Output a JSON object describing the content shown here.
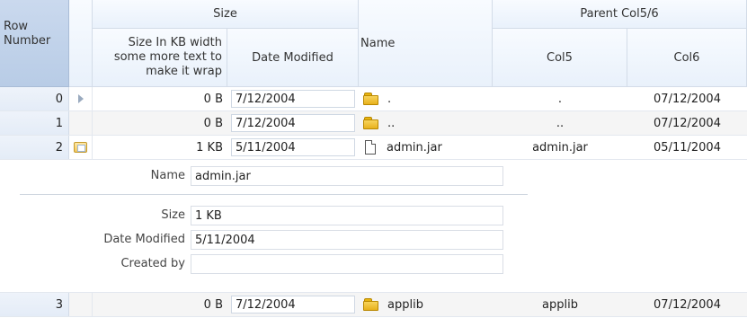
{
  "header": {
    "row_number": "Row\nNumber",
    "size_group": "Size",
    "size_kb": "Size In KB width some more text to make it wrap",
    "date_modified": "Date Modified",
    "name": "Name",
    "parent_group": "Parent Col5/6",
    "col5": "Col5",
    "col6": "Col6"
  },
  "rows": [
    {
      "num": "0",
      "size": "0 B",
      "date": "7/12/2004",
      "name": ".",
      "col5": ".",
      "col6": "07/12/2004",
      "icon": "folder-icon"
    },
    {
      "num": "1",
      "size": "0 B",
      "date": "7/12/2004",
      "name": "..",
      "col5": "..",
      "col6": "07/12/2004",
      "icon": "folder-icon"
    },
    {
      "num": "2",
      "size": "1 KB",
      "date": "5/11/2004",
      "name": "admin.jar",
      "col5": "admin.jar",
      "col6": "05/11/2004",
      "icon": "file-icon"
    },
    {
      "num": "3",
      "size": "0 B",
      "date": "7/12/2004",
      "name": "applib",
      "col5": "applib",
      "col6": "07/12/2004",
      "icon": "folder-icon"
    }
  ],
  "detail": {
    "name_label": "Name",
    "name_value": "admin.jar",
    "size_label": "Size",
    "size_value": "1 KB",
    "date_label": "Date Modified",
    "date_value": "5/11/2004",
    "created_label": "Created by",
    "created_value": ""
  }
}
